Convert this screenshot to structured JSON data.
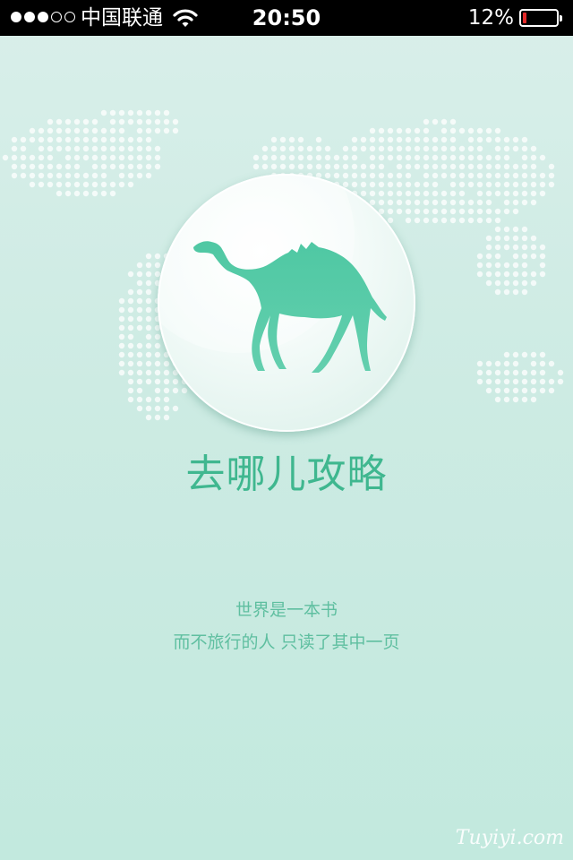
{
  "status_bar": {
    "carrier": "中国联通",
    "time": "20:50",
    "battery": "12%",
    "battery_level": 0.12,
    "signal_bars_filled": 3,
    "signal_bars_total": 5
  },
  "icons": {
    "wifi": "wifi-icon",
    "battery": "battery-icon",
    "logo": "camel-icon",
    "background": "world-map-dots"
  },
  "colors": {
    "accent": "#3fb78f",
    "camel": "#56c9a6",
    "background": "#cdebe3"
  },
  "app": {
    "title": "去哪儿攻略",
    "tagline_line1": "世界是一本书",
    "tagline_line2": "而不旅行的人  只读了其中一页"
  },
  "watermark": "Tuyiyi.com"
}
